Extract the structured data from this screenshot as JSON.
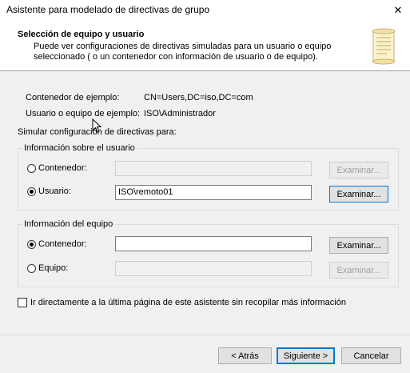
{
  "window": {
    "title": "Asistente para modelado de directivas de grupo",
    "close_glyph": "✕"
  },
  "header": {
    "title": "Selección de equipo y usuario",
    "description": "Puede ver configuraciones de directivas simuladas para un usuario o equipo seleccionado ( o un contenedor con información de usuario o de equipo)."
  },
  "info": {
    "container_label": "Contenedor de ejemplo:",
    "container_value": "CN=Users,DC=iso,DC=com",
    "user_label": "Usuario o equipo de ejemplo:",
    "user_value": "ISO\\Administrador"
  },
  "simulate_label": "Simular configuración de directivas para:",
  "user_group": {
    "legend": "Información sobre el usuario",
    "container_option": "Contenedor:",
    "container_value": "",
    "container_browse": "Examinar...",
    "user_option": "Usuario:",
    "user_value": "ISO\\remoto01",
    "user_browse": "Examinar..."
  },
  "computer_group": {
    "legend": "Información del equipo",
    "container_option": "Contenedor:",
    "container_value": "",
    "container_browse": "Examinar...",
    "computer_option": "Equipo:",
    "computer_value": "",
    "computer_browse": "Examinar..."
  },
  "skip_checkbox_label": "Ir directamente a la última página de este asistente sin recopilar más información",
  "footer": {
    "back": "< Atrás",
    "next": "Siguiente >",
    "cancel": "Cancelar"
  },
  "selection": {
    "user_mode": "Usuario",
    "computer_mode": "Contenedor",
    "skip_checked": false
  },
  "colors": {
    "accent": "#0078d7",
    "background": "#f0f0f0"
  }
}
